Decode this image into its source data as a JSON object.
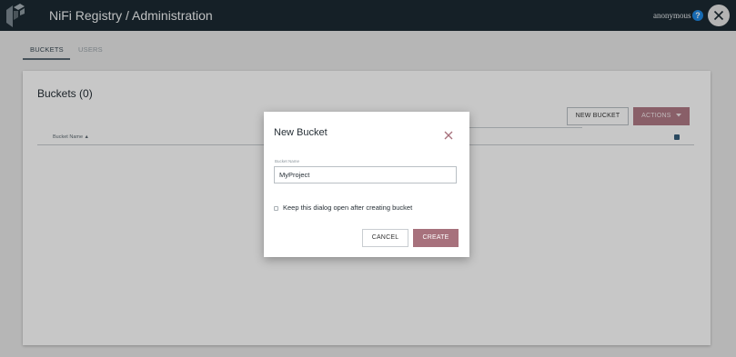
{
  "header": {
    "title": "NiFi Registry / Administration",
    "user": "anonymous",
    "help_symbol": "?",
    "icons": {
      "logo": "nifi-logo",
      "help": "help-icon",
      "close": "close-icon"
    }
  },
  "tabs": [
    {
      "label": "BUCKETS",
      "selected": true
    },
    {
      "label": "USERS",
      "selected": false
    }
  ],
  "buckets_panel": {
    "title": "Buckets (0)",
    "filter": {
      "value": "",
      "icon": "filter-icon"
    },
    "new_bucket_label": "NEW BUCKET",
    "actions_label": "ACTIONS",
    "actions_icon": "caret-down-icon",
    "column_header": "Bucket Name",
    "sort_indicator": "▲",
    "rows": []
  },
  "dialog": {
    "title": "New Bucket",
    "close_icon": "close-icon",
    "field_label": "Bucket Name",
    "field_value": "MyProject",
    "checkbox_label": "Keep this dialog open after creating bucket",
    "checkbox_checked": false,
    "cancel_label": "CANCEL",
    "create_label": "CREATE"
  },
  "colors": {
    "topbar": "#1c2a33",
    "accent": "#a7717c",
    "actions_button": "#b07a86",
    "help_icon": "#1e88e5",
    "page_background": "#eaeaea"
  }
}
